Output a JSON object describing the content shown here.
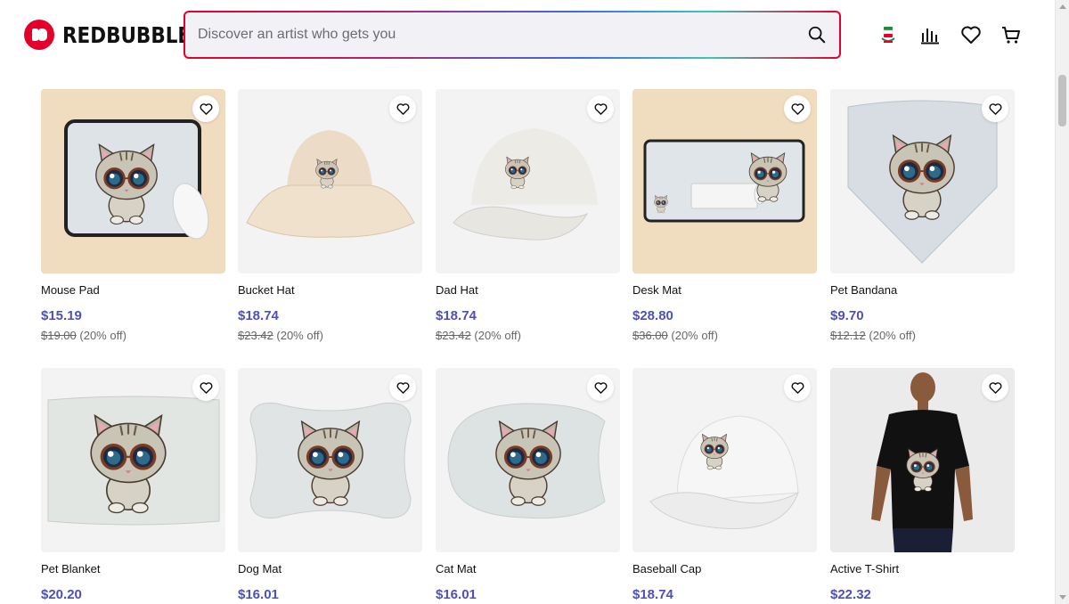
{
  "header": {
    "brand": "REDBUBBLE",
    "search_placeholder": "Discover an artist who gets you"
  },
  "products": [
    {
      "name": "Mouse Pad",
      "price": "$15.19",
      "original_price": "$19.00",
      "discount": "(20% off)",
      "image": "mouse-pad"
    },
    {
      "name": "Bucket Hat",
      "price": "$18.74",
      "original_price": "$23.42",
      "discount": "(20% off)",
      "image": "bucket-hat"
    },
    {
      "name": "Dad Hat",
      "price": "$18.74",
      "original_price": "$23.42",
      "discount": "(20% off)",
      "image": "dad-hat"
    },
    {
      "name": "Desk Mat",
      "price": "$28.80",
      "original_price": "$36.00",
      "discount": "(20% off)",
      "image": "desk-mat"
    },
    {
      "name": "Pet Bandana",
      "price": "$9.70",
      "original_price": "$12.12",
      "discount": "(20% off)",
      "image": "pet-bandana"
    },
    {
      "name": "Pet Blanket",
      "price": "$20.20",
      "image": "pet-blanket"
    },
    {
      "name": "Dog Mat",
      "price": "$16.01",
      "image": "dog-mat"
    },
    {
      "name": "Cat Mat",
      "price": "$16.01",
      "image": "cat-mat"
    },
    {
      "name": "Baseball Cap",
      "price": "$18.74",
      "image": "baseball-cap"
    },
    {
      "name": "Active T-Shirt",
      "price": "$22.32",
      "image": "active-t-shirt"
    }
  ],
  "colors": {
    "brand_red": "#e4002b",
    "price": "#4e50b8"
  }
}
